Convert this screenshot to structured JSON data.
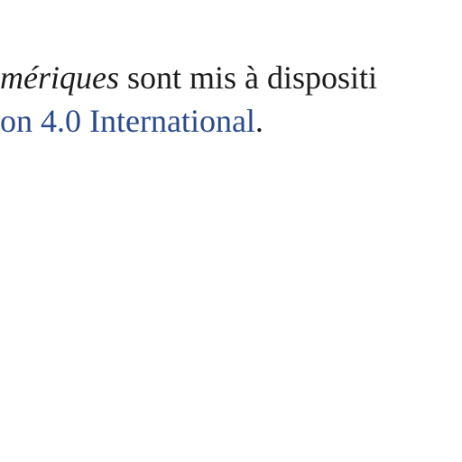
{
  "document": {
    "line1": {
      "italic_fragment": "mériques",
      "rest": " sont mis à dispositi"
    },
    "line2": {
      "link_text": "on 4.0 International",
      "trailing": "."
    }
  },
  "colors": {
    "text": "#1c1c1c",
    "link": "#2a4a8c",
    "background": "#ffffff"
  }
}
